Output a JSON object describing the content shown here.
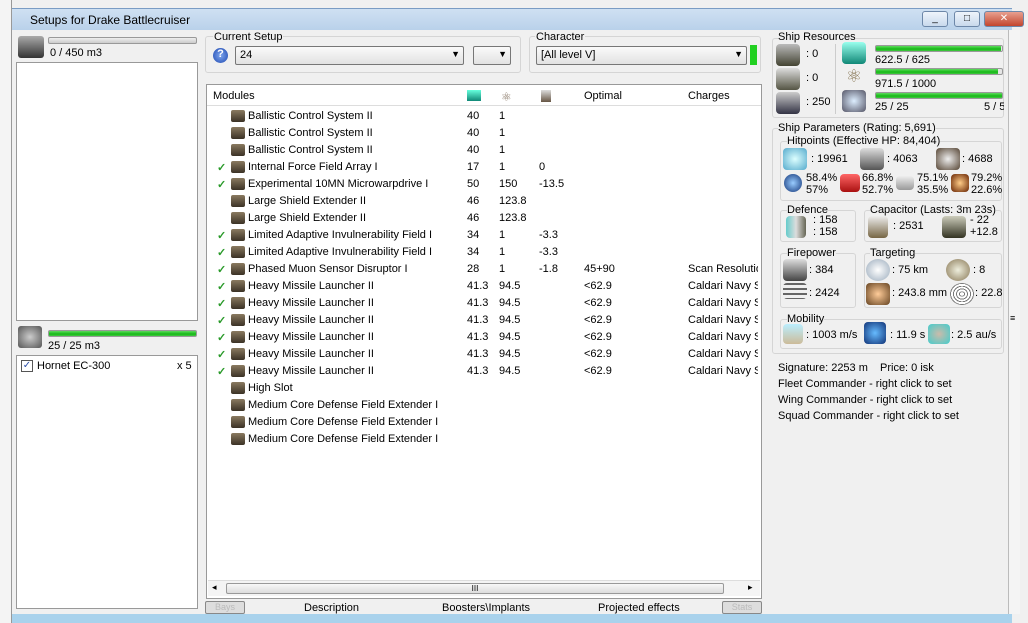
{
  "window": {
    "title": "Setups for Drake Battlecruiser"
  },
  "cargo": {
    "label": "0 / 450 m3",
    "fill": 0
  },
  "drones_bay": {
    "label": "25 / 25 m3",
    "fill": 1,
    "items": [
      {
        "name": "Hornet EC-300",
        "qty": "x 5",
        "checked": true
      }
    ]
  },
  "setup": {
    "group_label": "Current Setup",
    "value": "24"
  },
  "character": {
    "group_label": "Character",
    "value": "[All level V]"
  },
  "modules": {
    "headers": {
      "name": "Modules",
      "optimal": "Optimal",
      "charges": "Charges"
    },
    "rows": [
      {
        "check": "",
        "name": "Ballistic Control System II",
        "cpu": "40",
        "pg": "1",
        "cap": "",
        "optimal": "",
        "charges": ""
      },
      {
        "check": "",
        "name": "Ballistic Control System II",
        "cpu": "40",
        "pg": "1",
        "cap": "",
        "optimal": "",
        "charges": ""
      },
      {
        "check": "",
        "name": "Ballistic Control System II",
        "cpu": "40",
        "pg": "1",
        "cap": "",
        "optimal": "",
        "charges": ""
      },
      {
        "check": "✓",
        "name": "Internal Force Field Array I",
        "cpu": "17",
        "pg": "1",
        "cap": "0",
        "optimal": "",
        "charges": ""
      },
      {
        "check": "✓",
        "name": "Experimental 10MN Microwarpdrive I",
        "cpu": "50",
        "pg": "150",
        "cap": "-13.5",
        "optimal": "",
        "charges": ""
      },
      {
        "check": "",
        "name": "Large Shield Extender II",
        "cpu": "46",
        "pg": "123.8",
        "cap": "",
        "optimal": "",
        "charges": ""
      },
      {
        "check": "",
        "name": "Large Shield Extender II",
        "cpu": "46",
        "pg": "123.8",
        "cap": "",
        "optimal": "",
        "charges": ""
      },
      {
        "check": "✓",
        "name": "Limited Adaptive Invulnerability Field I",
        "cpu": "34",
        "pg": "1",
        "cap": "-3.3",
        "optimal": "",
        "charges": ""
      },
      {
        "check": "✓",
        "name": "Limited Adaptive Invulnerability Field I",
        "cpu": "34",
        "pg": "1",
        "cap": "-3.3",
        "optimal": "",
        "charges": ""
      },
      {
        "check": "✓",
        "name": "Phased Muon Sensor Disruptor I",
        "cpu": "28",
        "pg": "1",
        "cap": "-1.8",
        "optimal": "45+90",
        "charges": "Scan Resolutio"
      },
      {
        "check": "✓",
        "name": "Heavy Missile Launcher II",
        "cpu": "41.3",
        "pg": "94.5",
        "cap": "",
        "optimal": "<62.9",
        "charges": "Caldari Navy Sc"
      },
      {
        "check": "✓",
        "name": "Heavy Missile Launcher II",
        "cpu": "41.3",
        "pg": "94.5",
        "cap": "",
        "optimal": "<62.9",
        "charges": "Caldari Navy Sc"
      },
      {
        "check": "✓",
        "name": "Heavy Missile Launcher II",
        "cpu": "41.3",
        "pg": "94.5",
        "cap": "",
        "optimal": "<62.9",
        "charges": "Caldari Navy Sc"
      },
      {
        "check": "✓",
        "name": "Heavy Missile Launcher II",
        "cpu": "41.3",
        "pg": "94.5",
        "cap": "",
        "optimal": "<62.9",
        "charges": "Caldari Navy Sc"
      },
      {
        "check": "✓",
        "name": "Heavy Missile Launcher II",
        "cpu": "41.3",
        "pg": "94.5",
        "cap": "",
        "optimal": "<62.9",
        "charges": "Caldari Navy Sc"
      },
      {
        "check": "✓",
        "name": "Heavy Missile Launcher II",
        "cpu": "41.3",
        "pg": "94.5",
        "cap": "",
        "optimal": "<62.9",
        "charges": "Caldari Navy Sc"
      },
      {
        "check": "",
        "name": "High Slot",
        "cpu": "",
        "pg": "",
        "cap": "",
        "optimal": "",
        "charges": ""
      },
      {
        "check": "",
        "name": "Medium Core Defense Field Extender I",
        "cpu": "",
        "pg": "",
        "cap": "",
        "optimal": "",
        "charges": ""
      },
      {
        "check": "",
        "name": "Medium Core Defense Field Extender I",
        "cpu": "",
        "pg": "",
        "cap": "",
        "optimal": "",
        "charges": ""
      },
      {
        "check": "",
        "name": "Medium Core Defense Field Extender I",
        "cpu": "",
        "pg": "",
        "cap": "",
        "optimal": "",
        "charges": ""
      }
    ]
  },
  "tabs": {
    "bays": "Bays",
    "description": "Description",
    "boosters": "Boosters\\Implants",
    "projected": "Projected effects",
    "stats": "Stats"
  },
  "resources": {
    "title": "Ship Resources",
    "turrets": ": 0",
    "launchers": ": 0",
    "calibration": ": 250",
    "cpu": "622.5 / 625",
    "cpu_fill": 0.996,
    "pg": "971.5 / 1000",
    "pg_fill": 0.9715,
    "drone_bw": "25 / 25",
    "drone_bw_fill": 1,
    "drones_active": "5 / 5"
  },
  "params": {
    "title": "Ship Parameters (Rating: 5,691)",
    "hp_title": "Hitpoints (Effective HP: 84,404)",
    "shield": ": 19961",
    "armor": ": 4063",
    "hull": ": 4688",
    "em": [
      "58.4%",
      "57%"
    ],
    "thermal": [
      "66.8%",
      "52.7%"
    ],
    "kinetic": [
      "75.1%",
      "35.5%"
    ],
    "explosive": [
      "79.2%",
      "22.6%"
    ],
    "defence_title": "Defence",
    "def1": ": 158",
    "def2": ": 158",
    "cap_title": "Capacitor (Lasts: 3m 23s)",
    "cap_amount": ": 2531",
    "cap_use": "- 22",
    "cap_regen": "+12.8",
    "fp_title": "Firepower",
    "dps": ": 384",
    "volley": ": 2424",
    "tgt_title": "Targeting",
    "range": ": 75 km",
    "targets": ": 8",
    "scanres": ": 243.8 mm",
    "sensor": ": 22.8",
    "mob_title": "Mobility",
    "speed": ": 1003 m/s",
    "align": ": 11.9 s",
    "warp": ": 2.5 au/s",
    "signature": "Signature: 2253 m",
    "price": "Price: 0 isk",
    "fleet": "Fleet Commander - right click to set",
    "wing": "Wing Commander - right click to set",
    "squad": "Squad Commander - right click to set"
  },
  "colors": {
    "bar": "#16b816",
    "check": "#2a9a2a",
    "title": "#b9d1ea"
  }
}
